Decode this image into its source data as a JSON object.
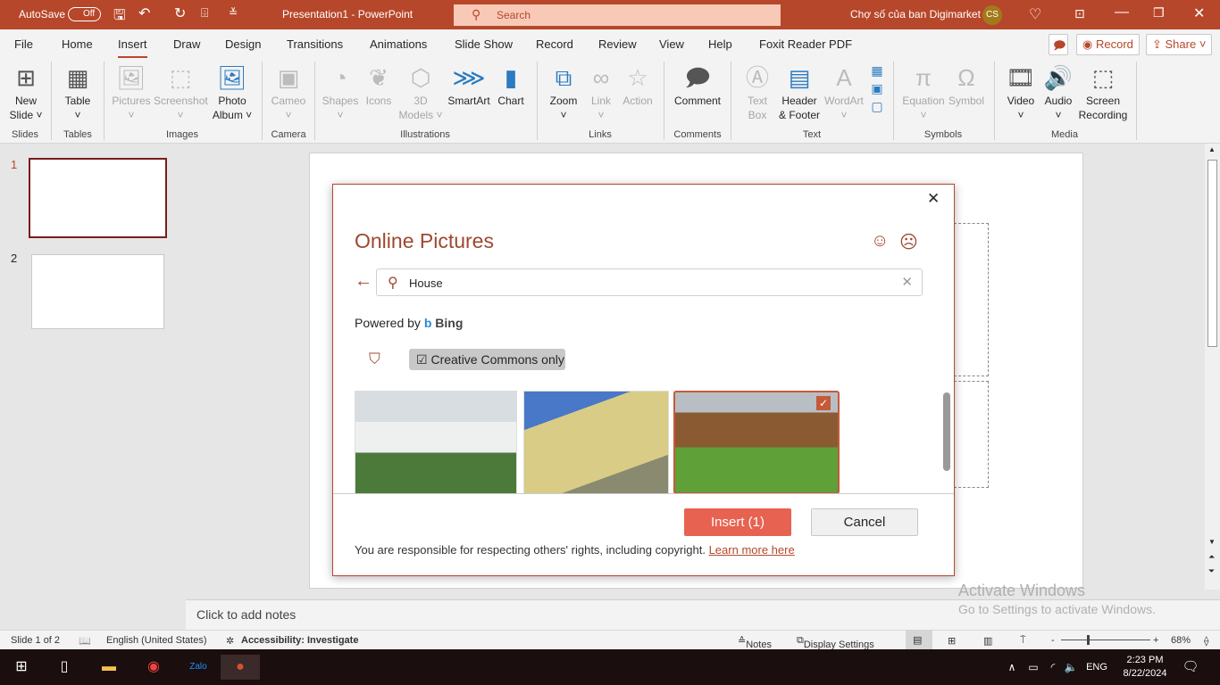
{
  "titlebar": {
    "autosave": "AutoSave",
    "autosave_state": "Off",
    "doc_title": "Presentation1  -  PowerPoint",
    "search_placeholder": "Search",
    "user_name": "Chợ số của ban Digimarket",
    "user_initials": "CS",
    "accent": "#b7472a"
  },
  "tabs": [
    "File",
    "Home",
    "Insert",
    "Draw",
    "Design",
    "Transitions",
    "Animations",
    "Slide Show",
    "Record",
    "Review",
    "View",
    "Help",
    "Foxit Reader PDF"
  ],
  "active_tab": "Insert",
  "header_buttons": {
    "record": "Record",
    "share": "Share"
  },
  "ribbon": {
    "groups": [
      "Slides",
      "Tables",
      "Images",
      "Camera",
      "Illustrations",
      "Links",
      "Comments",
      "Text",
      "Symbols",
      "Media"
    ],
    "items": [
      {
        "label": "New",
        "label2": "Slide ˅",
        "icon": "new-slide-icon",
        "disabled": false
      },
      {
        "label": "Table",
        "label2": "˅",
        "icon": "table-icon",
        "disabled": false
      },
      {
        "label": "Pictures",
        "label2": "˅",
        "icon": "pictures-icon",
        "disabled": true
      },
      {
        "label": "Screenshot",
        "label2": "˅",
        "icon": "screenshot-icon",
        "disabled": true
      },
      {
        "label": "Photo",
        "label2": "Album ˅",
        "icon": "photo-album-icon",
        "disabled": false
      },
      {
        "label": "Cameo",
        "label2": "˅",
        "icon": "cameo-icon",
        "disabled": true
      },
      {
        "label": "Shapes",
        "label2": "˅",
        "icon": "shapes-icon",
        "disabled": true
      },
      {
        "label": "Icons",
        "label2": "",
        "icon": "icons-icon",
        "disabled": true
      },
      {
        "label": "3D",
        "label2": "Models ˅",
        "icon": "3d-models-icon",
        "disabled": true
      },
      {
        "label": "SmartArt",
        "label2": "",
        "icon": "smartart-icon",
        "disabled": false
      },
      {
        "label": "Chart",
        "label2": "",
        "icon": "chart-icon",
        "disabled": false
      },
      {
        "label": "Zoom",
        "label2": "˅",
        "icon": "zoom-icon",
        "disabled": false
      },
      {
        "label": "Link",
        "label2": "˅",
        "icon": "link-icon",
        "disabled": true
      },
      {
        "label": "Action",
        "label2": "",
        "icon": "action-icon",
        "disabled": true
      },
      {
        "label": "Comment",
        "label2": "",
        "icon": "comment-icon",
        "disabled": false
      },
      {
        "label": "Text",
        "label2": "Box",
        "icon": "text-box-icon",
        "disabled": true
      },
      {
        "label": "Header",
        "label2": "& Footer",
        "icon": "header-footer-icon",
        "disabled": false
      },
      {
        "label": "WordArt",
        "label2": "˅",
        "icon": "wordart-icon",
        "disabled": true
      },
      {
        "label": "",
        "label2": "",
        "icon": "date-time-icon",
        "disabled": false
      },
      {
        "label": "Equation",
        "label2": "˅",
        "icon": "equation-icon",
        "disabled": true
      },
      {
        "label": "Symbol",
        "label2": "",
        "icon": "symbol-icon",
        "disabled": true
      },
      {
        "label": "Video",
        "label2": "˅",
        "icon": "video-icon",
        "disabled": false
      },
      {
        "label": "Audio",
        "label2": "˅",
        "icon": "audio-icon",
        "disabled": false
      },
      {
        "label": "Screen",
        "label2": "Recording",
        "icon": "screen-recording-icon",
        "disabled": false
      }
    ]
  },
  "slides": {
    "numbers": [
      "1",
      "2"
    ],
    "selected": "1"
  },
  "notes_placeholder": "Click to add notes",
  "dialog": {
    "title": "Online Pictures",
    "search_value": "House",
    "powered_by": "Powered by",
    "bing": "Bing",
    "filter_label": "Creative Commons only",
    "filter_checked": true,
    "images": [
      {
        "desc": "white house",
        "selected": false
      },
      {
        "desc": "victorian mansion",
        "selected": false
      },
      {
        "desc": "wooden cabin",
        "selected": true
      }
    ],
    "insert_label": "Insert (1)",
    "cancel_label": "Cancel",
    "disclaimer": "You are responsible for respecting others' rights, including copyright.",
    "learn_more": "Learn more here",
    "insert_color": "#e76250"
  },
  "watermark": {
    "line1": "Activate Windows",
    "line2": "Go to Settings to activate Windows."
  },
  "status": {
    "slide": "Slide 1 of 2",
    "language": "English (United States)",
    "accessibility": "Accessibility: Investigate",
    "notes": "Notes",
    "display": "Display Settings",
    "zoom": "68%",
    "zoom_minus": "-",
    "zoom_plus": "+"
  },
  "taskbar": {
    "language": "ENG",
    "time": "2:23 PM",
    "date": "8/22/2024"
  }
}
